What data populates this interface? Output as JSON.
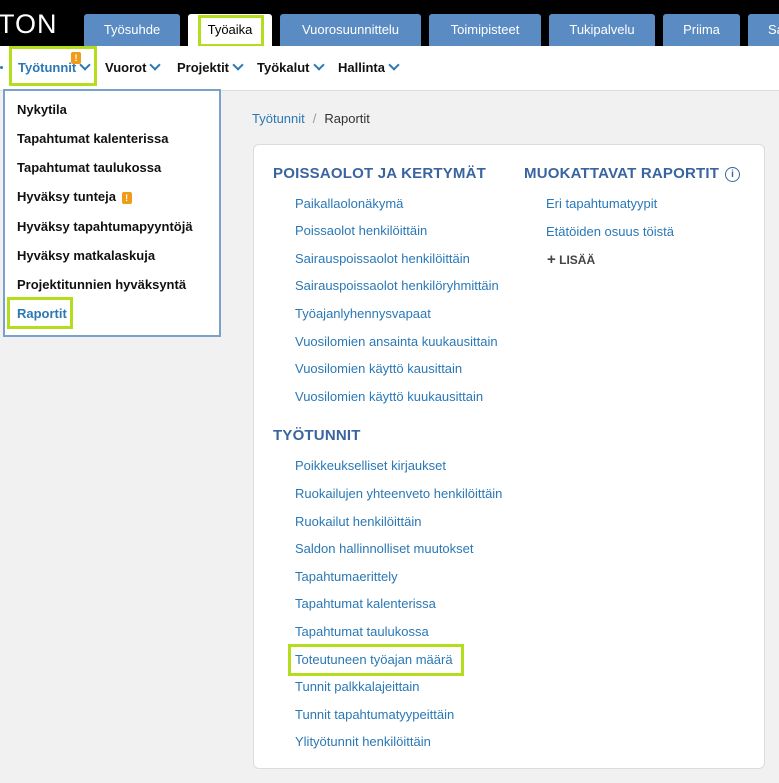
{
  "brand": {
    "logo_text": "TON"
  },
  "top_tabs": [
    {
      "label": "Työsuhde"
    },
    {
      "label": "Työaika"
    },
    {
      "label": "Vuorosuunnittelu"
    },
    {
      "label": "Toimipisteet"
    },
    {
      "label": "Tukipalvelu"
    },
    {
      "label": "Priima"
    },
    {
      "label": "Sa"
    }
  ],
  "nav": {
    "items": [
      {
        "label": "Työtunnit"
      },
      {
        "label": "Vuorot"
      },
      {
        "label": "Projektit"
      },
      {
        "label": "Työkalut"
      },
      {
        "label": "Hallinta"
      }
    ],
    "badge": "!"
  },
  "dropdown": {
    "items": [
      {
        "label": "Nykytila"
      },
      {
        "label": "Tapahtumat kalenterissa"
      },
      {
        "label": "Tapahtumat taulukossa"
      },
      {
        "label": "Hyväksy tunteja"
      },
      {
        "label": "Hyväksy tapahtumapyyntöjä"
      },
      {
        "label": "Hyväksy matkalaskuja"
      },
      {
        "label": "Projektitunnien hyväksyntä"
      },
      {
        "label": "Raportit"
      }
    ],
    "badge": "!"
  },
  "breadcrumb": {
    "parent": "Työtunnit",
    "separator": "/",
    "current": "Raportit"
  },
  "sections": {
    "absences": {
      "title": "POISSAOLOT JA KERTYMÄT",
      "links": [
        "Paikallaolonäkymä",
        "Poissaolot henkilöittäin",
        "Sairauspoissaolot henkilöittäin",
        "Sairauspoissaolot henkilöryhmittäin",
        "Työajanlyhennysvapaat",
        "Vuosilomien ansainta kuukausittain",
        "Vuosilomien käyttö kausittain",
        "Vuosilomien käyttö kuukausittain"
      ]
    },
    "custom": {
      "title": "MUOKATTAVAT RAPORTIT",
      "info": "i",
      "links": [
        "Eri tapahtumatyypit",
        "Etätöiden osuus töistä"
      ],
      "add_label": "LISÄÄ",
      "add_symbol": "+"
    },
    "hours": {
      "title": "TYÖTUNNIT",
      "links": [
        "Poikkeukselliset kirjaukset",
        "Ruokailujen yhteenveto henkilöittäin",
        "Ruokailut henkilöittäin",
        "Saldon hallinnolliset muutokset",
        "Tapahtumaerittely",
        "Tapahtumat kalenterissa",
        "Tapahtumat taulukossa",
        "Toteutuneen työajan määrä",
        "Tunnit palkkalajeittain",
        "Tunnit tapahtumatyypeittäin",
        "Ylityötunnit henkilöittäin"
      ]
    }
  }
}
